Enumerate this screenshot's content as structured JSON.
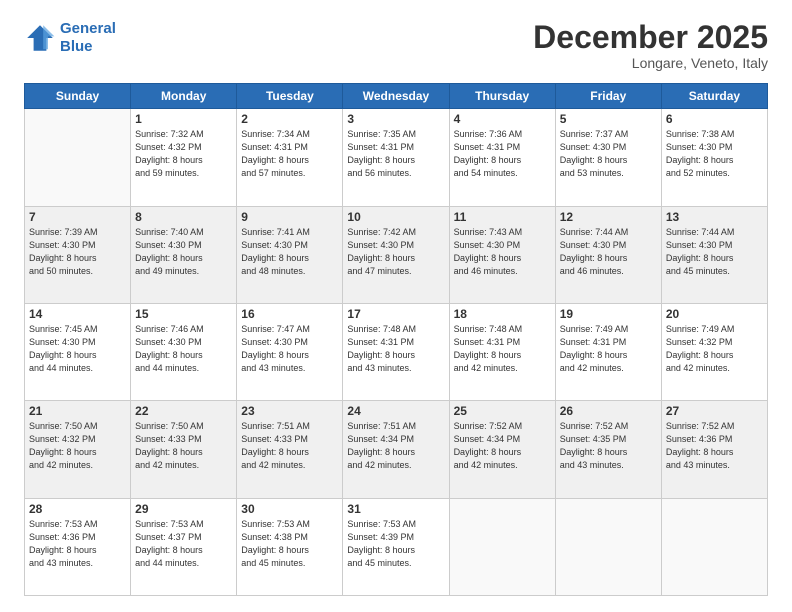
{
  "header": {
    "logo_line1": "General",
    "logo_line2": "Blue",
    "month": "December 2025",
    "location": "Longare, Veneto, Italy"
  },
  "days_of_week": [
    "Sunday",
    "Monday",
    "Tuesday",
    "Wednesday",
    "Thursday",
    "Friday",
    "Saturday"
  ],
  "weeks": [
    [
      {
        "day": "",
        "info": ""
      },
      {
        "day": "1",
        "info": "Sunrise: 7:32 AM\nSunset: 4:32 PM\nDaylight: 8 hours\nand 59 minutes."
      },
      {
        "day": "2",
        "info": "Sunrise: 7:34 AM\nSunset: 4:31 PM\nDaylight: 8 hours\nand 57 minutes."
      },
      {
        "day": "3",
        "info": "Sunrise: 7:35 AM\nSunset: 4:31 PM\nDaylight: 8 hours\nand 56 minutes."
      },
      {
        "day": "4",
        "info": "Sunrise: 7:36 AM\nSunset: 4:31 PM\nDaylight: 8 hours\nand 54 minutes."
      },
      {
        "day": "5",
        "info": "Sunrise: 7:37 AM\nSunset: 4:30 PM\nDaylight: 8 hours\nand 53 minutes."
      },
      {
        "day": "6",
        "info": "Sunrise: 7:38 AM\nSunset: 4:30 PM\nDaylight: 8 hours\nand 52 minutes."
      }
    ],
    [
      {
        "day": "7",
        "info": "Sunrise: 7:39 AM\nSunset: 4:30 PM\nDaylight: 8 hours\nand 50 minutes."
      },
      {
        "day": "8",
        "info": "Sunrise: 7:40 AM\nSunset: 4:30 PM\nDaylight: 8 hours\nand 49 minutes."
      },
      {
        "day": "9",
        "info": "Sunrise: 7:41 AM\nSunset: 4:30 PM\nDaylight: 8 hours\nand 48 minutes."
      },
      {
        "day": "10",
        "info": "Sunrise: 7:42 AM\nSunset: 4:30 PM\nDaylight: 8 hours\nand 47 minutes."
      },
      {
        "day": "11",
        "info": "Sunrise: 7:43 AM\nSunset: 4:30 PM\nDaylight: 8 hours\nand 46 minutes."
      },
      {
        "day": "12",
        "info": "Sunrise: 7:44 AM\nSunset: 4:30 PM\nDaylight: 8 hours\nand 46 minutes."
      },
      {
        "day": "13",
        "info": "Sunrise: 7:44 AM\nSunset: 4:30 PM\nDaylight: 8 hours\nand 45 minutes."
      }
    ],
    [
      {
        "day": "14",
        "info": "Sunrise: 7:45 AM\nSunset: 4:30 PM\nDaylight: 8 hours\nand 44 minutes."
      },
      {
        "day": "15",
        "info": "Sunrise: 7:46 AM\nSunset: 4:30 PM\nDaylight: 8 hours\nand 44 minutes."
      },
      {
        "day": "16",
        "info": "Sunrise: 7:47 AM\nSunset: 4:30 PM\nDaylight: 8 hours\nand 43 minutes."
      },
      {
        "day": "17",
        "info": "Sunrise: 7:48 AM\nSunset: 4:31 PM\nDaylight: 8 hours\nand 43 minutes."
      },
      {
        "day": "18",
        "info": "Sunrise: 7:48 AM\nSunset: 4:31 PM\nDaylight: 8 hours\nand 42 minutes."
      },
      {
        "day": "19",
        "info": "Sunrise: 7:49 AM\nSunset: 4:31 PM\nDaylight: 8 hours\nand 42 minutes."
      },
      {
        "day": "20",
        "info": "Sunrise: 7:49 AM\nSunset: 4:32 PM\nDaylight: 8 hours\nand 42 minutes."
      }
    ],
    [
      {
        "day": "21",
        "info": "Sunrise: 7:50 AM\nSunset: 4:32 PM\nDaylight: 8 hours\nand 42 minutes."
      },
      {
        "day": "22",
        "info": "Sunrise: 7:50 AM\nSunset: 4:33 PM\nDaylight: 8 hours\nand 42 minutes."
      },
      {
        "day": "23",
        "info": "Sunrise: 7:51 AM\nSunset: 4:33 PM\nDaylight: 8 hours\nand 42 minutes."
      },
      {
        "day": "24",
        "info": "Sunrise: 7:51 AM\nSunset: 4:34 PM\nDaylight: 8 hours\nand 42 minutes."
      },
      {
        "day": "25",
        "info": "Sunrise: 7:52 AM\nSunset: 4:34 PM\nDaylight: 8 hours\nand 42 minutes."
      },
      {
        "day": "26",
        "info": "Sunrise: 7:52 AM\nSunset: 4:35 PM\nDaylight: 8 hours\nand 43 minutes."
      },
      {
        "day": "27",
        "info": "Sunrise: 7:52 AM\nSunset: 4:36 PM\nDaylight: 8 hours\nand 43 minutes."
      }
    ],
    [
      {
        "day": "28",
        "info": "Sunrise: 7:53 AM\nSunset: 4:36 PM\nDaylight: 8 hours\nand 43 minutes."
      },
      {
        "day": "29",
        "info": "Sunrise: 7:53 AM\nSunset: 4:37 PM\nDaylight: 8 hours\nand 44 minutes."
      },
      {
        "day": "30",
        "info": "Sunrise: 7:53 AM\nSunset: 4:38 PM\nDaylight: 8 hours\nand 45 minutes."
      },
      {
        "day": "31",
        "info": "Sunrise: 7:53 AM\nSunset: 4:39 PM\nDaylight: 8 hours\nand 45 minutes."
      },
      {
        "day": "",
        "info": ""
      },
      {
        "day": "",
        "info": ""
      },
      {
        "day": "",
        "info": ""
      }
    ]
  ]
}
